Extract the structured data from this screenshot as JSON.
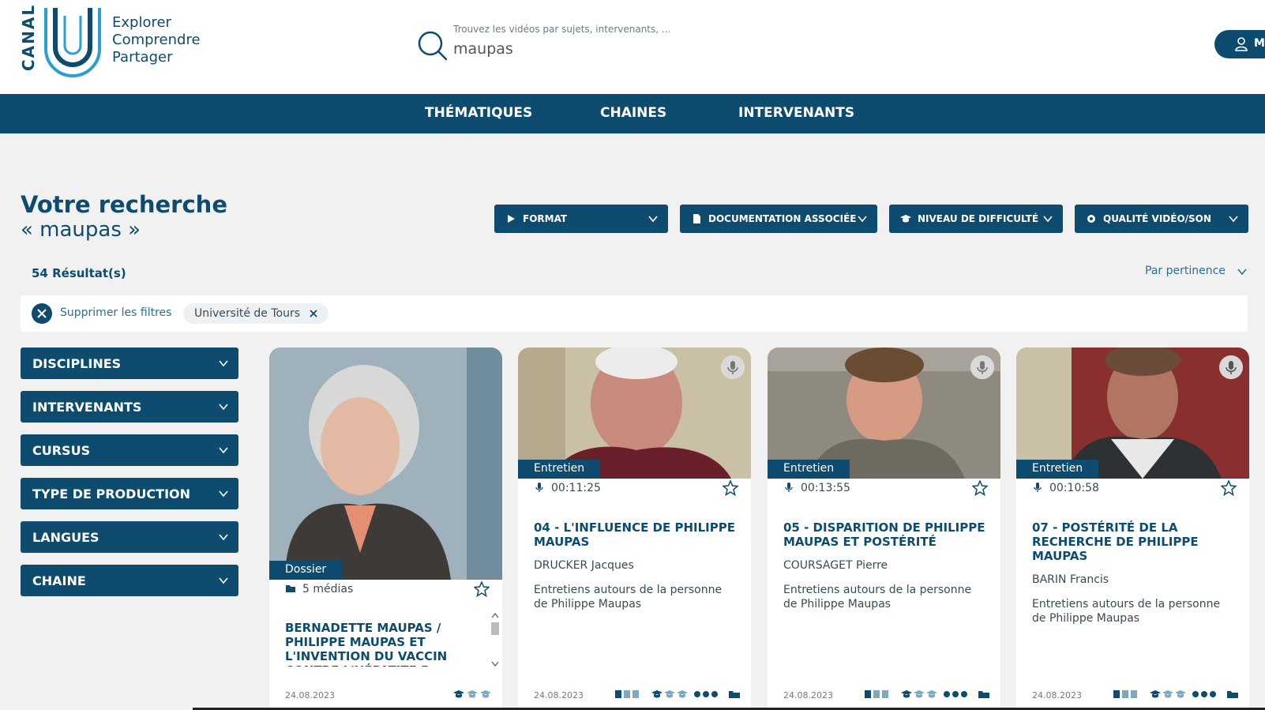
{
  "header": {
    "logo_text": "CANAL",
    "tagline": [
      "Explorer",
      "Comprendre",
      "Partager"
    ],
    "search": {
      "hint": "Trouvez les vidéos par sujets, intervenants, ...",
      "value": "maupas"
    },
    "account_label": "Mo"
  },
  "nav": {
    "items": [
      "THÉMATIQUES",
      "CHAINES",
      "INTERVENANTS"
    ]
  },
  "search_title": {
    "heading": "Votre recherche",
    "query": "« maupas »"
  },
  "top_filters": [
    {
      "label": "FORMAT",
      "icon": "play-icon"
    },
    {
      "label": "DOCUMENTATION ASSOCIÉE",
      "icon": "document-icon"
    },
    {
      "label": "NIVEAU DE DIFFICULTÉ",
      "icon": "graduation-cap-icon"
    },
    {
      "label": "QUALITÉ VIDÉO/SON",
      "icon": "gear-icon"
    }
  ],
  "results_count": "54 Résultat(s)",
  "sort_label": "Par pertinence",
  "active_filters": {
    "clear_label": "Supprimer les filtres",
    "chips": [
      "Université de Tours"
    ]
  },
  "sidebar": {
    "filters": [
      "DISCIPLINES",
      "INTERVENANTS",
      "CURSUS",
      "TYPE DE PRODUCTION",
      "LANGUES",
      "CHAINE"
    ]
  },
  "cards": [
    {
      "badge": "Dossier",
      "meta": "5 médias",
      "title": "BERNADETTE MAUPAS / PHILIPPE MAUPAS ET L'INVENTION DU VACCIN CONTRE L'HÉPATITE B",
      "author": "",
      "description": "",
      "date": "24.08.2023"
    },
    {
      "badge": "Entretien",
      "meta": "00:11:25",
      "title": "04 - L'INFLUENCE DE PHILIPPE MAUPAS",
      "author": "DRUCKER Jacques",
      "description": "Entretiens autours de la personne de Philippe Maupas",
      "date": "24.08.2023"
    },
    {
      "badge": "Entretien",
      "meta": "00:13:55",
      "title": "05 - DISPARITION DE PHILIPPE MAUPAS ET POSTÉRITÉ",
      "author": "COURSAGET Pierre",
      "description": "Entretiens autours de la personne de Philippe Maupas",
      "date": "24.08.2023"
    },
    {
      "badge": "Entretien",
      "meta": "00:10:58",
      "title": "07 - POSTÉRITÉ DE LA RECHERCHE DE PHILIPPE MAUPAS",
      "author": "BARIN Francis",
      "description": "Entretiens autours de la personne de Philippe Maupas",
      "date": "24.08.2023"
    }
  ],
  "colors": {
    "brand": "#0d4c6e",
    "accent": "#2a9fd6",
    "page_bg": "#f1f1f1"
  }
}
